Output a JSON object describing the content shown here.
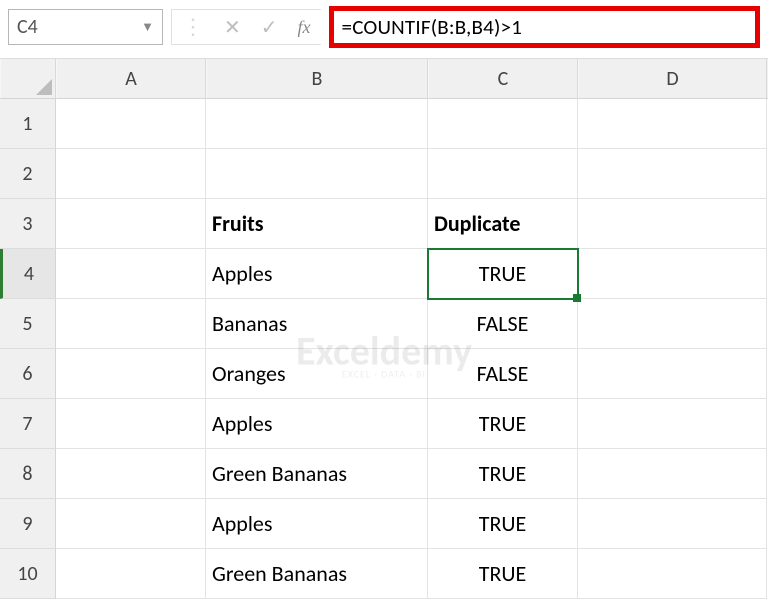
{
  "formula_bar": {
    "namebox_value": "C4",
    "fx_label": "fx",
    "formula_text": "=COUNTIF(B:B,B4)>1"
  },
  "columns": {
    "A": "A",
    "B": "B",
    "C": "C",
    "D": "D"
  },
  "rows_index": [
    "1",
    "2",
    "3",
    "4",
    "5",
    "6",
    "7",
    "8",
    "9",
    "10"
  ],
  "headers_row": {
    "B": "Fruits",
    "C": "Duplicate"
  },
  "data_rows": [
    {
      "B": "Apples",
      "C": "TRUE"
    },
    {
      "B": "Bananas",
      "C": "FALSE"
    },
    {
      "B": "Oranges",
      "C": "FALSE"
    },
    {
      "B": "Apples",
      "C": "TRUE"
    },
    {
      "B": "Green Bananas",
      "C": "TRUE"
    },
    {
      "B": "Apples",
      "C": "TRUE"
    },
    {
      "B": "Green Bananas",
      "C": "TRUE"
    }
  ],
  "active_cell": "C4",
  "watermark": {
    "main": "Exceldemy",
    "sub": "EXCEL · DATA · BI"
  }
}
